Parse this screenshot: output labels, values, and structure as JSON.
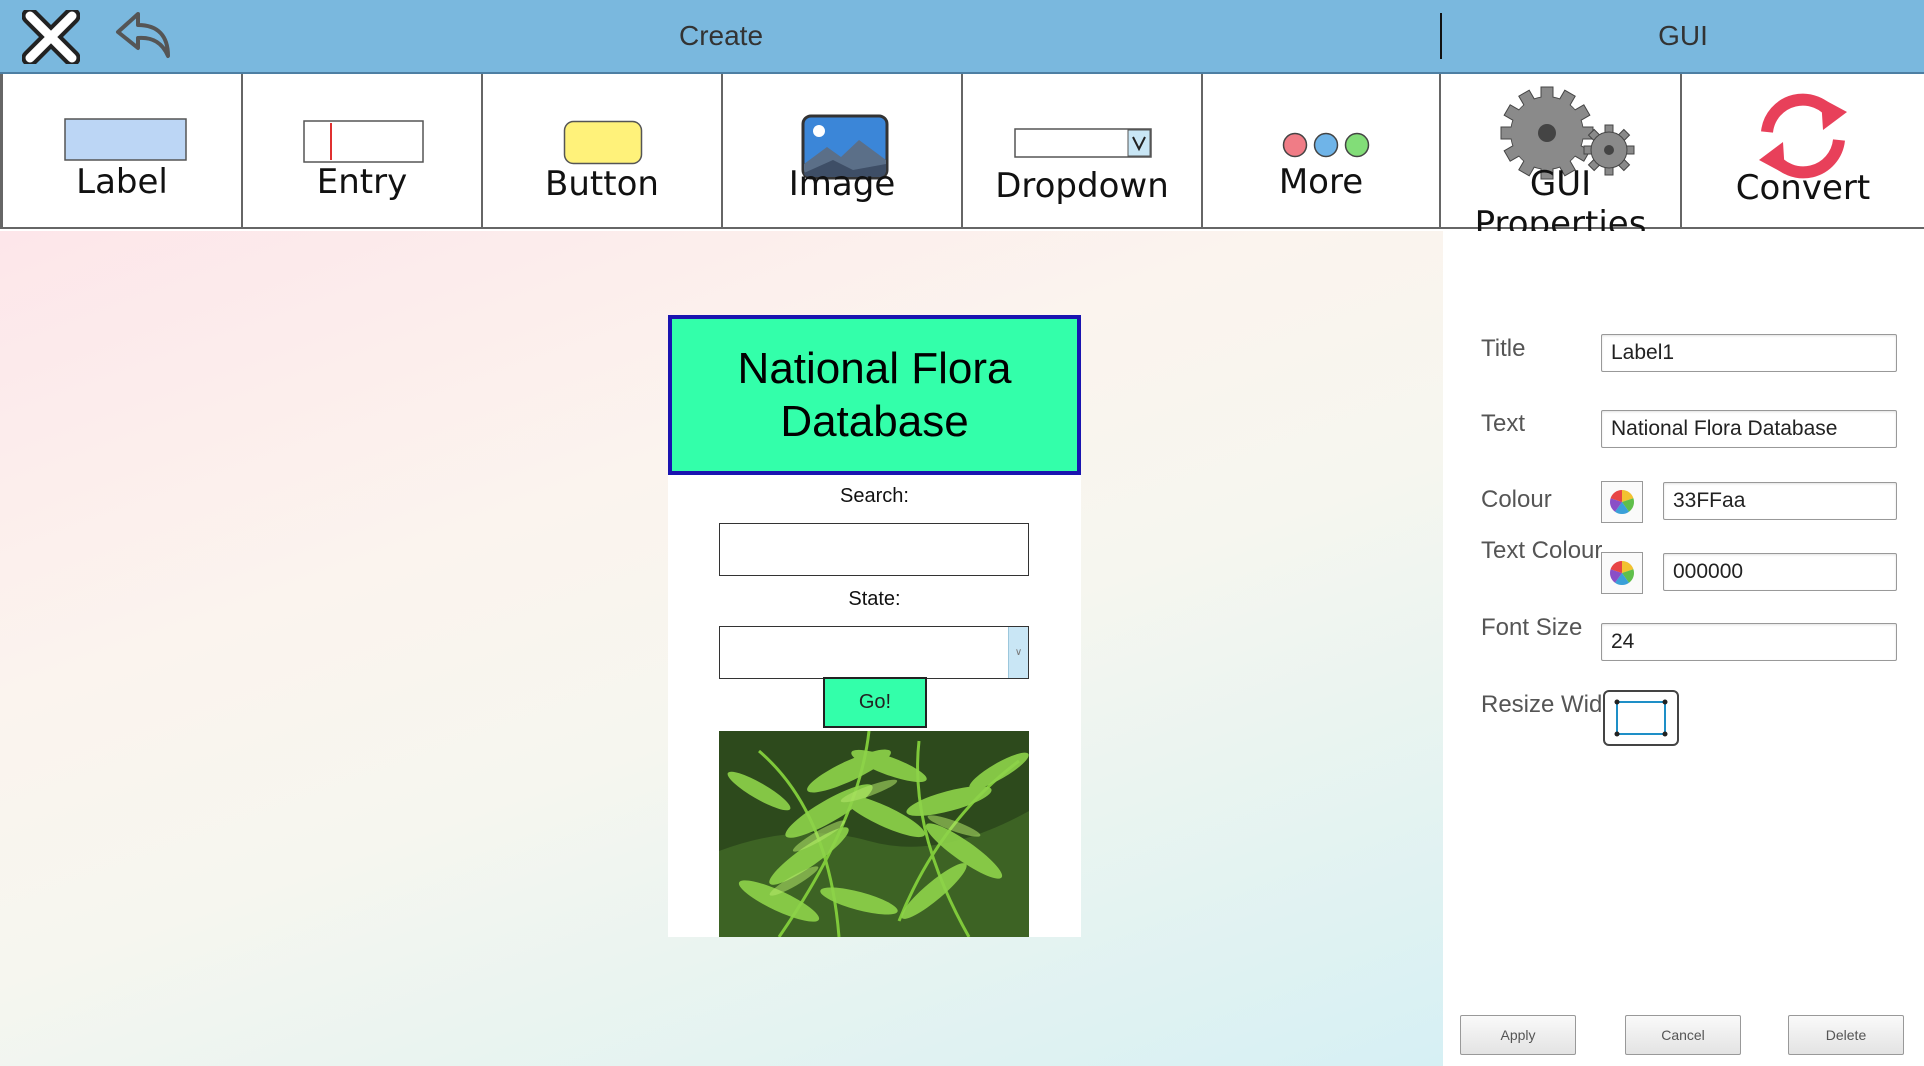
{
  "topbar": {
    "create_title": "Create",
    "gui_title": "GUI",
    "close_icon": "close-x-icon",
    "undo_icon": "undo-arrow-icon",
    "color": "#7ab8de"
  },
  "toolbar": {
    "items": [
      {
        "label": "Label",
        "icon": "label-widget-icon"
      },
      {
        "label": "Entry",
        "icon": "entry-widget-icon"
      },
      {
        "label": "Button",
        "icon": "button-widget-icon"
      },
      {
        "label": "Image",
        "icon": "image-widget-icon"
      },
      {
        "label": "Dropdown",
        "icon": "dropdown-widget-icon"
      },
      {
        "label": "More",
        "icon": "more-dots-icon"
      },
      {
        "label": "GUI Properties",
        "icon": "gears-icon"
      },
      {
        "label": "Convert",
        "icon": "convert-arrows-icon"
      }
    ]
  },
  "preview": {
    "title": "National Flora Database",
    "title_bg": "#33FFaa",
    "title_border": "#1a14b0",
    "search_label": "Search:",
    "search_value": "",
    "state_label": "State:",
    "state_value": "",
    "go_label": "Go!",
    "image": "fern-leaves-photo"
  },
  "properties": {
    "title_label": "Title",
    "title_value": "Label1",
    "text_label": "Text",
    "text_value": "National Flora Database",
    "colour_label": "Colour",
    "colour_value": "33FFaa",
    "text_colour_label": "Text Colour",
    "text_colour_value": "000000",
    "font_size_label": "Font Size",
    "font_size_value": "24",
    "resize_label": "Resize Widget",
    "apply_label": "Apply",
    "cancel_label": "Cancel",
    "delete_label": "Delete"
  }
}
